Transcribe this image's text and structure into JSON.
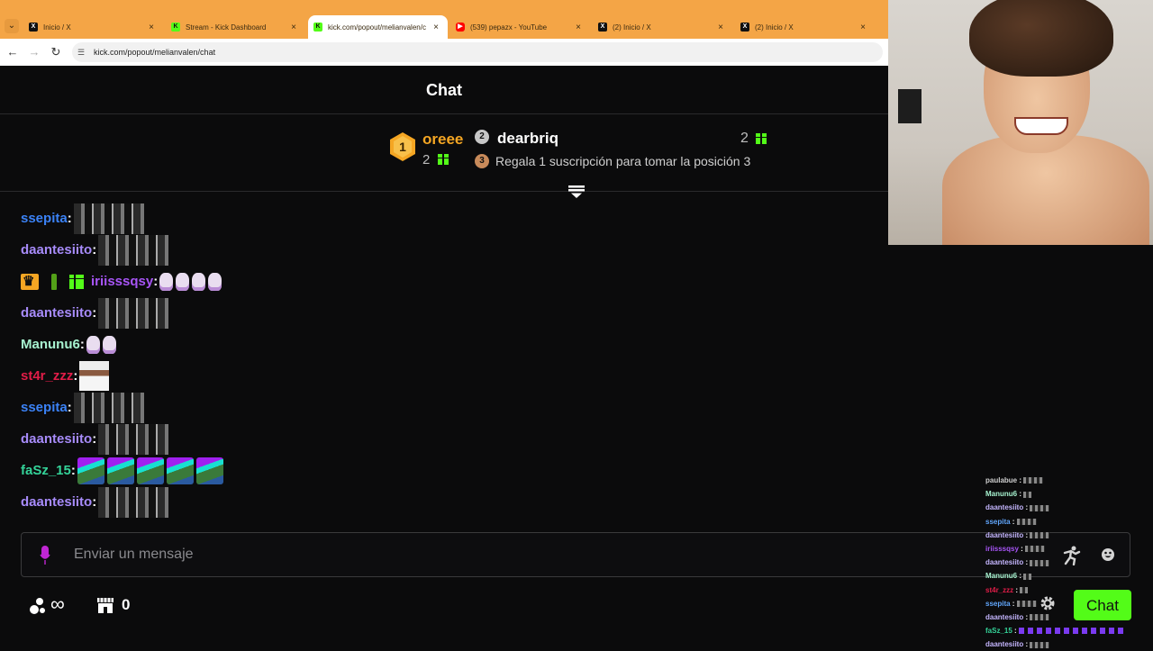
{
  "browser": {
    "tabs": [
      {
        "label": "Inicio / X",
        "favicon": "x-icon",
        "active": false,
        "close": "×"
      },
      {
        "label": "Stream - Kick Dashboard",
        "favicon": "kick-icon",
        "active": false,
        "close": "×"
      },
      {
        "label": "kick.com/popout/melianvalen/c",
        "favicon": "kick-icon",
        "active": true,
        "close": "×"
      },
      {
        "label": "(539) pepazx - YouTube",
        "favicon": "youtube-icon",
        "active": false,
        "close": "×"
      },
      {
        "label": "(2) Inicio / X",
        "favicon": "x-icon",
        "active": false,
        "close": "×"
      },
      {
        "label": "(2) Inicio / X",
        "favicon": "x-icon",
        "active": false,
        "close": "×"
      }
    ],
    "url": "kick.com/popout/melianvalen/chat"
  },
  "chat": {
    "title": "Chat",
    "leaderboard": {
      "first": {
        "rank": "1",
        "name": "oreee",
        "count": "2"
      },
      "second": {
        "rank": "2",
        "name": "dearbriq",
        "count": "2"
      },
      "third": {
        "rank": "3",
        "text": "Regala 1 suscripción para tomar la posición 3"
      }
    },
    "messages": [
      {
        "user": "ssepita",
        "color": "#3b82f6",
        "emote": "wide"
      },
      {
        "user": "daantesiito",
        "color": "#a78bfa",
        "emote": "wide"
      },
      {
        "user": "iriisssqsy",
        "color": "#a855f7",
        "emote": "cats",
        "badges": [
          "crown-icon",
          "bottle-icon",
          "gift-icon"
        ]
      },
      {
        "user": "daantesiito",
        "color": "#a78bfa",
        "emote": "wide"
      },
      {
        "user": "Manunu6",
        "color": "#a7f3d0",
        "emote": "cats-small"
      },
      {
        "user": "st4r_zzz",
        "color": "#e11d48",
        "emote": "photo"
      },
      {
        "user": "ssepita",
        "color": "#3b82f6",
        "emote": "wide"
      },
      {
        "user": "daantesiito",
        "color": "#a78bfa",
        "emote": "wide"
      },
      {
        "user": "faSz_15",
        "color": "#34d399",
        "emote": "frogs"
      },
      {
        "user": "daantesiito",
        "color": "#a78bfa",
        "emote": "wide"
      }
    ],
    "input_placeholder": "Enviar un mensaje",
    "points_value": "∞",
    "store_count": "0",
    "send_label": "Chat"
  },
  "overlay_chat": [
    {
      "user": "paulabue",
      "color": "#cfcfcf"
    },
    {
      "user": "Manunu6",
      "color": "#a7f3d0"
    },
    {
      "user": "daantesiito",
      "color": "#c4b5fd"
    },
    {
      "user": "ssepita",
      "color": "#60a5fa"
    },
    {
      "user": "daantesiito",
      "color": "#c4b5fd"
    },
    {
      "user": "iriisssqsy",
      "color": "#a855f7"
    },
    {
      "user": "daantesiito",
      "color": "#c4b5fd"
    },
    {
      "user": "Manunu6",
      "color": "#a7f3d0"
    },
    {
      "user": "st4r_zzz",
      "color": "#e11d48"
    },
    {
      "user": "ssepita",
      "color": "#60a5fa"
    },
    {
      "user": "daantesiito",
      "color": "#c4b5fd"
    },
    {
      "user": "faSz_15",
      "color": "#34d399"
    },
    {
      "user": "daantesiito",
      "color": "#c4b5fd"
    }
  ],
  "colors": {
    "kick_green": "#53fc18",
    "gold": "#f5a623",
    "background": "#0b0b0c"
  }
}
